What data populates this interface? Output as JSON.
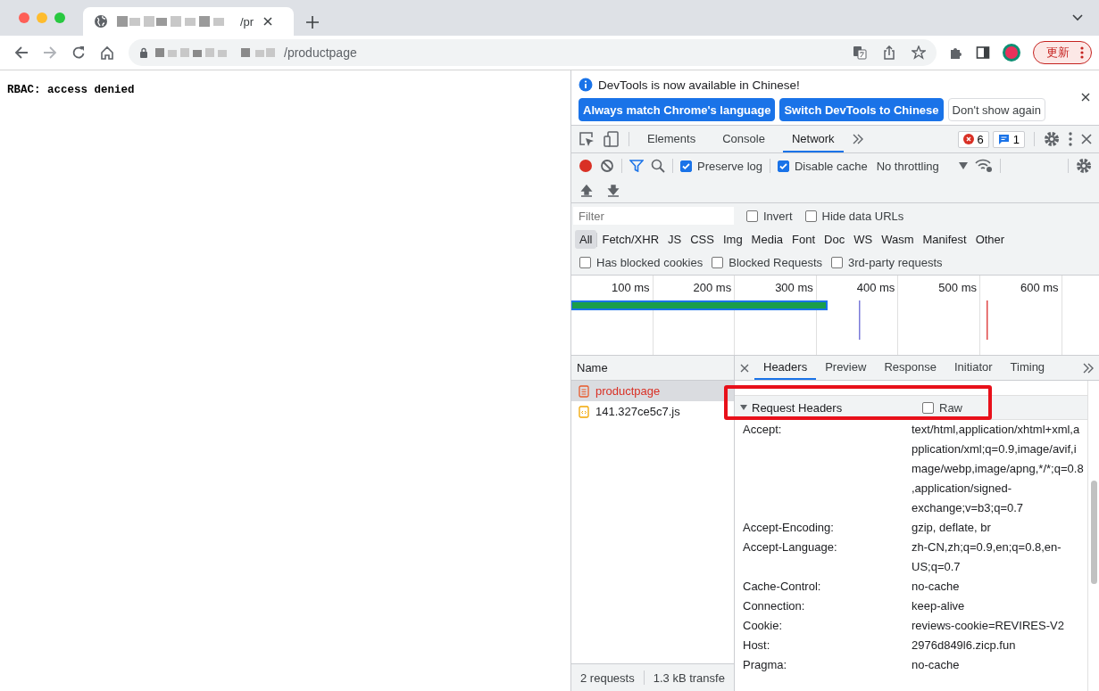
{
  "browser": {
    "tab": {
      "title": "/pr"
    },
    "address": {
      "url": "/productpage"
    },
    "update_button": "更新"
  },
  "page": {
    "text": "RBAC: access denied"
  },
  "devtools": {
    "infobar": {
      "message": "DevTools is now available in Chinese!",
      "buttons": [
        {
          "label": "Always match Chrome's language",
          "kind": "primary"
        },
        {
          "label": "Switch DevTools to Chinese",
          "kind": "primary"
        },
        {
          "label": "Don't show again",
          "kind": "secondary"
        }
      ]
    },
    "tabs": [
      {
        "label": "Elements",
        "selected": false
      },
      {
        "label": "Console",
        "selected": false
      },
      {
        "label": "Network",
        "selected": true
      }
    ],
    "error_count": "6",
    "message_count": "1",
    "toolbar": {
      "recording": true,
      "preserve_log": {
        "label": "Preserve log",
        "checked": true
      },
      "disable_cache": {
        "label": "Disable cache",
        "checked": true
      },
      "throttling": "No throttling"
    },
    "filter": {
      "placeholder": "Filter"
    },
    "filter_options": [
      {
        "label": "Invert",
        "checked": false
      },
      {
        "label": "Hide data URLs",
        "checked": false
      }
    ],
    "types": [
      {
        "label": "All",
        "selected": true
      },
      {
        "label": "Fetch/XHR",
        "selected": false
      },
      {
        "label": "JS",
        "selected": false
      },
      {
        "label": "CSS",
        "selected": false
      },
      {
        "label": "Img",
        "selected": false
      },
      {
        "label": "Media",
        "selected": false
      },
      {
        "label": "Font",
        "selected": false
      },
      {
        "label": "Doc",
        "selected": false
      },
      {
        "label": "WS",
        "selected": false
      },
      {
        "label": "Wasm",
        "selected": false
      },
      {
        "label": "Manifest",
        "selected": false
      },
      {
        "label": "Other",
        "selected": false
      }
    ],
    "options": [
      {
        "label": "Has blocked cookies",
        "checked": false
      },
      {
        "label": "Blocked Requests",
        "checked": false
      },
      {
        "label": "3rd-party requests",
        "checked": false
      }
    ],
    "timeline": {
      "ticks": [
        "100 ms",
        "200 ms",
        "300 ms",
        "400 ms",
        "500 ms",
        "600 ms"
      ]
    },
    "name_header": "Name",
    "requests": [
      {
        "name": "productpage",
        "kind": "document",
        "selected": true,
        "failed": true
      },
      {
        "name": "141.327ce5c7.js",
        "kind": "script",
        "selected": false,
        "failed": false
      }
    ],
    "detail_tabs": [
      {
        "label": "Headers",
        "selected": true
      },
      {
        "label": "Preview",
        "selected": false
      },
      {
        "label": "Response",
        "selected": false
      },
      {
        "label": "Initiator",
        "selected": false
      },
      {
        "label": "Timing",
        "selected": false
      }
    ],
    "request_headers": {
      "title": "Request Headers",
      "expanded": true,
      "raw": {
        "label": "Raw",
        "checked": false
      },
      "rows": [
        {
          "name": "Accept:",
          "value": "text/html,application/xhtml+xml,application/xml;q=0.9,image/avif,image/webp,image/apng,*/*;q=0.8,application/signed-exchange;v=b3;q=0.7"
        },
        {
          "name": "Accept-Encoding:",
          "value": "gzip, deflate, br"
        },
        {
          "name": "Accept-Language:",
          "value": "zh-CN,zh;q=0.9,en;q=0.8,en-US;q=0.7"
        },
        {
          "name": "Cache-Control:",
          "value": "no-cache"
        },
        {
          "name": "Connection:",
          "value": "keep-alive"
        },
        {
          "name": "Cookie:",
          "value": "reviews-cookie=REVIRES-V2"
        },
        {
          "name": "Host:",
          "value": "2976d849l6.zicp.fun"
        },
        {
          "name": "Pragma:",
          "value": "no-cache"
        }
      ]
    },
    "status": [
      "2 requests",
      "1.3 kB transfe"
    ]
  }
}
